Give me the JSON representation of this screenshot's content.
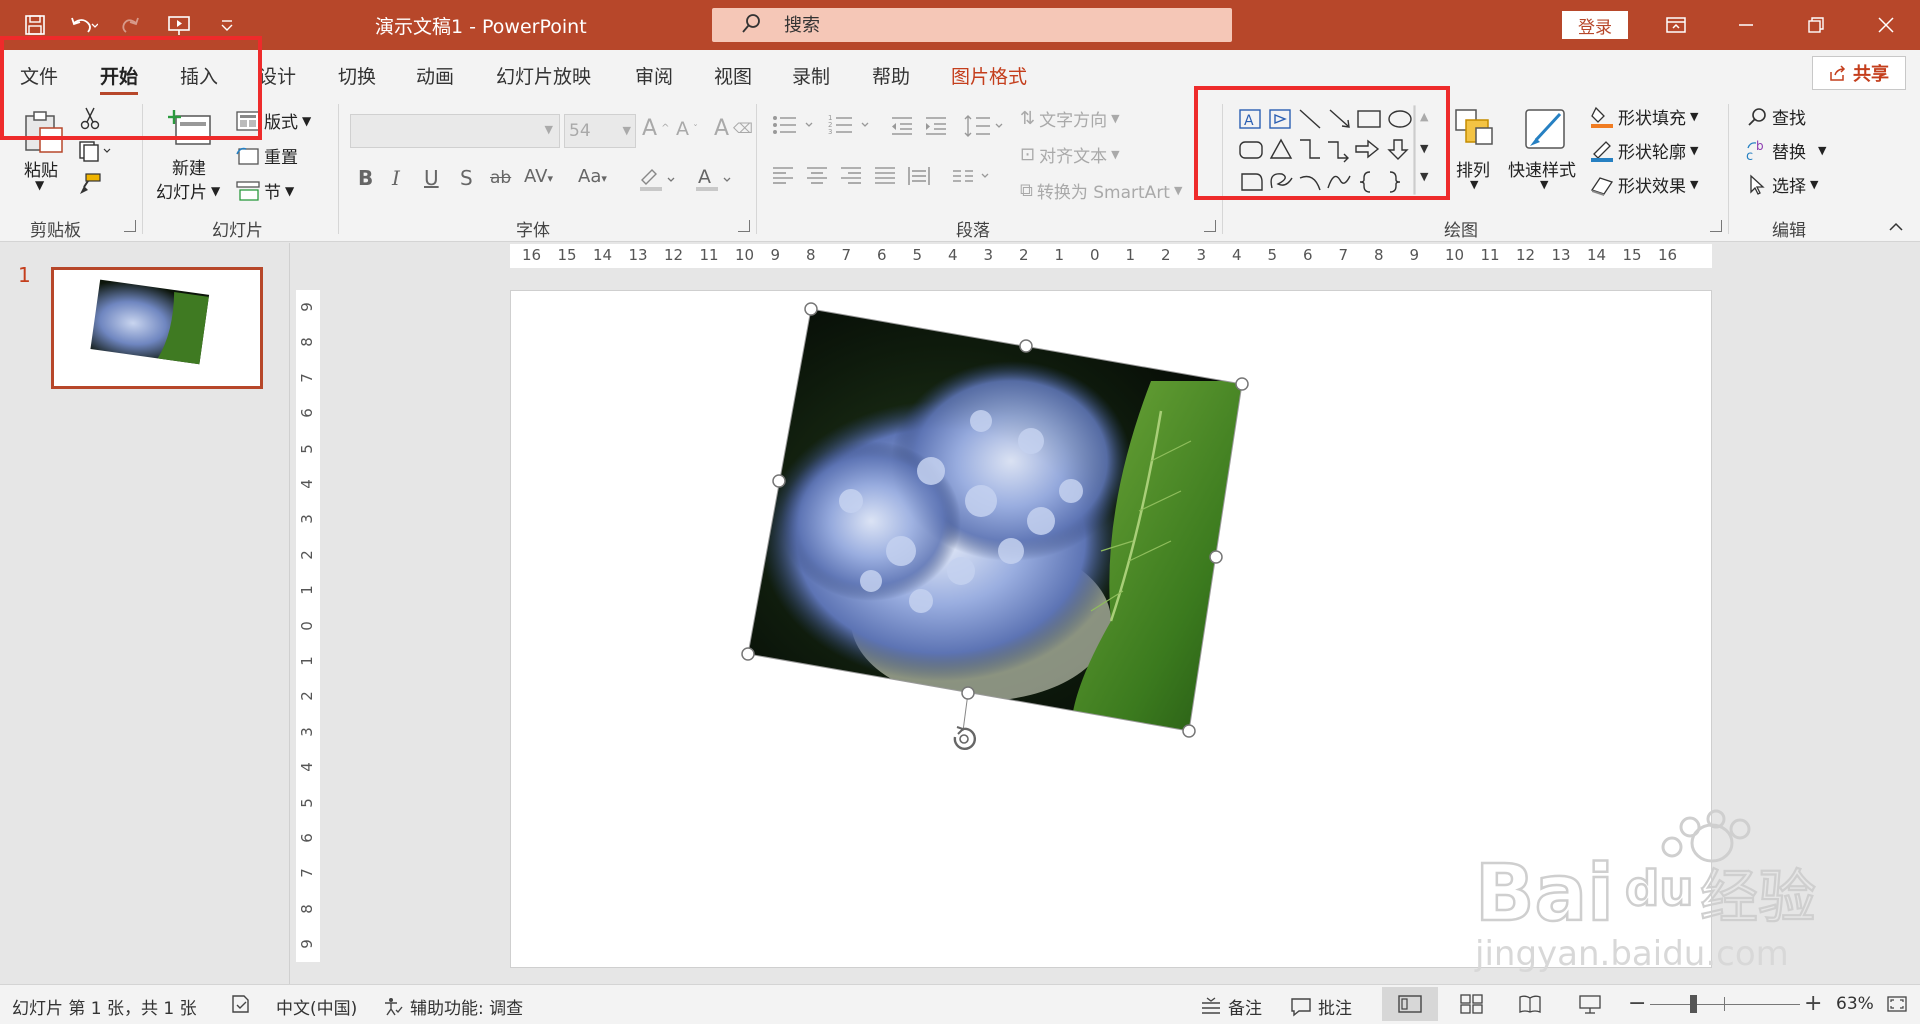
{
  "titlebar": {
    "doc_title": "演示文稿1  -  PowerPoint",
    "search_placeholder": "搜索",
    "login_label": "登录"
  },
  "tabs": [
    {
      "label": "文件"
    },
    {
      "label": "开始"
    },
    {
      "label": "插入"
    },
    {
      "label": "设计"
    },
    {
      "label": "切换"
    },
    {
      "label": "动画"
    },
    {
      "label": "幻灯片放映"
    },
    {
      "label": "审阅"
    },
    {
      "label": "视图"
    },
    {
      "label": "录制"
    },
    {
      "label": "帮助"
    },
    {
      "label": "图片格式"
    }
  ],
  "share_label": "共享",
  "ribbon": {
    "clipboard": {
      "paste": "粘贴",
      "group": "剪贴板"
    },
    "slides": {
      "new_slide_line1": "新建",
      "new_slide_line2": "幻灯片",
      "layout": "版式",
      "reset": "重置",
      "section": "节",
      "group": "幻灯片"
    },
    "font": {
      "size": "54",
      "group": "字体"
    },
    "paragraph": {
      "text_direction": "文字方向",
      "align_text": "对齐文本",
      "smartart": "转换为 SmartArt",
      "group": "段落"
    },
    "drawing": {
      "arrange": "排列",
      "quick_styles": "快速样式",
      "fill": "形状填充",
      "outline": "形状轮廓",
      "effects": "形状效果",
      "group": "绘图"
    },
    "editing": {
      "find": "查找",
      "replace": "替换",
      "select": "选择",
      "group": "编辑"
    }
  },
  "thumbnails": [
    {
      "number": "1"
    }
  ],
  "hruler_labels": [
    "16",
    "15",
    "14",
    "13",
    "12",
    "11",
    "10",
    "9",
    "8",
    "7",
    "6",
    "5",
    "4",
    "3",
    "2",
    "1",
    "0",
    "1",
    "2",
    "3",
    "4",
    "5",
    "6",
    "7",
    "8",
    "9",
    "10",
    "11",
    "12",
    "13",
    "14",
    "15",
    "16"
  ],
  "vruler_labels": [
    "9",
    "8",
    "7",
    "6",
    "5",
    "4",
    "3",
    "2",
    "1",
    "0",
    "1",
    "2",
    "3",
    "4",
    "5",
    "6",
    "7",
    "8",
    "9"
  ],
  "watermark": {
    "brand_a": "Bai",
    "brand_b": "du",
    "brand_c": "经验",
    "url": "jingyan.baidu.com"
  },
  "status": {
    "slide_info": "幻灯片 第 1 张，共 1 张",
    "language": "中文(中国)",
    "accessibility": "辅助功能: 调查",
    "notes": "备注",
    "comments": "批注",
    "zoom": "63%"
  }
}
